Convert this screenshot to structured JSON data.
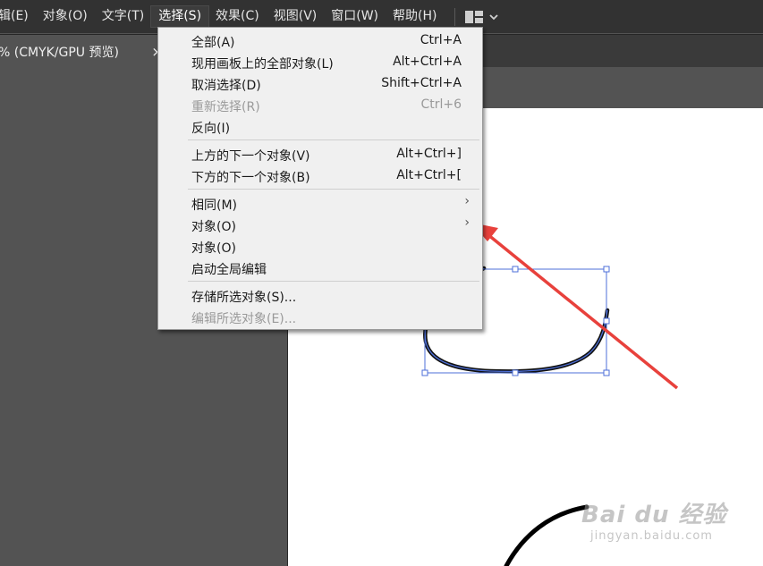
{
  "menubar": {
    "items": [
      {
        "label": "辑(E)"
      },
      {
        "label": "对象(O)"
      },
      {
        "label": "文字(T)"
      },
      {
        "label": "选择(S)"
      },
      {
        "label": "效果(C)"
      },
      {
        "label": "视图(V)"
      },
      {
        "label": "窗口(W)"
      },
      {
        "label": "帮助(H)"
      }
    ],
    "workspace_icon": "workspace-layout-icon",
    "dropdown_icon": "chevron-down-icon"
  },
  "document_tab": {
    "title": "% (CMYK/GPU 预览)",
    "close": "×"
  },
  "select_menu": {
    "groups": [
      [
        {
          "label": "全部(A)",
          "shortcut": "Ctrl+A"
        },
        {
          "label": "现用画板上的全部对象(L)",
          "shortcut": "Alt+Ctrl+A"
        },
        {
          "label": "取消选择(D)",
          "shortcut": "Shift+Ctrl+A"
        },
        {
          "label": "重新选择(R)",
          "shortcut": "Ctrl+6",
          "disabled": true
        },
        {
          "label": "反向(I)",
          "shortcut": ""
        }
      ],
      [
        {
          "label": "上方的下一个对象(V)",
          "shortcut": "Alt+Ctrl+]"
        },
        {
          "label": "下方的下一个对象(B)",
          "shortcut": "Alt+Ctrl+["
        }
      ],
      [
        {
          "label": "相同(M)",
          "submenu": true
        },
        {
          "label": "对象(O)",
          "submenu": true
        },
        {
          "label": "对象(O)",
          "shortcut": ""
        },
        {
          "label": "启动全局编辑",
          "shortcut": ""
        }
      ],
      [
        {
          "label": "存储所选对象(S)...",
          "shortcut": ""
        },
        {
          "label": "编辑所选对象(E)...",
          "shortcut": "",
          "disabled": true
        }
      ]
    ],
    "submenu_arrow": "›"
  },
  "annotation": {
    "color": "#e8413c"
  },
  "watermark": {
    "main": "Bai du 经验",
    "sub": "jingyan.baidu.com"
  },
  "colors": {
    "menubar_bg": "#323232",
    "workspace_bg": "#535353",
    "menu_bg": "#f0f0f0",
    "selection_blue": "#4d6fd8",
    "arrow_red": "#e8413c"
  }
}
